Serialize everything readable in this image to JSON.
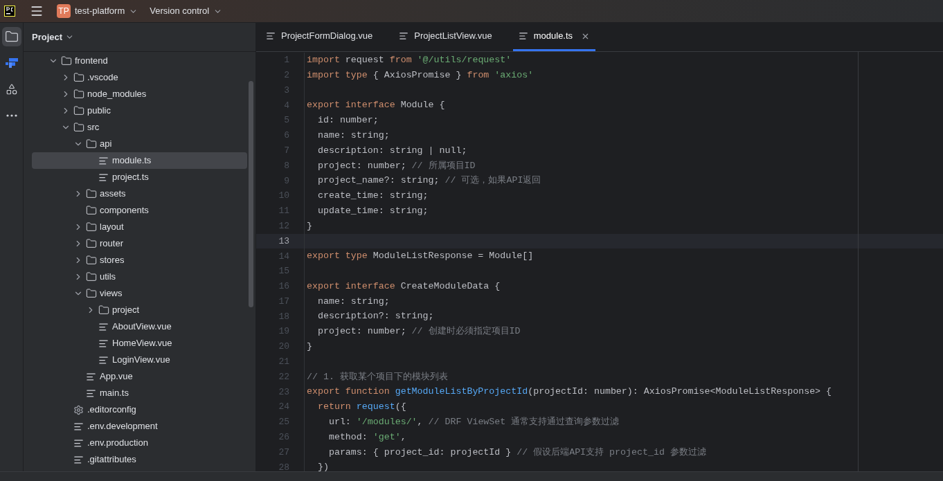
{
  "title_bar": {
    "app_badge": "TP",
    "project": "test-platform",
    "vcs": "Version control"
  },
  "side_rail": [
    {
      "kind": "folder",
      "selected": true
    },
    {
      "kind": "logo",
      "selected": false
    },
    {
      "kind": "components",
      "selected": false
    },
    {
      "kind": "more",
      "selected": false
    }
  ],
  "sidebar": {
    "title": "Project",
    "tree": [
      {
        "label": "frontend",
        "kind": "folder",
        "expanded": true,
        "selected": false,
        "children": [
          {
            "label": ".vscode",
            "kind": "folder",
            "expanded": false,
            "selected": false
          },
          {
            "label": "node_modules",
            "kind": "folder",
            "expanded": false,
            "selected": false
          },
          {
            "label": "public",
            "kind": "folder",
            "expanded": false,
            "selected": false
          },
          {
            "label": "src",
            "kind": "folder",
            "expanded": true,
            "selected": false,
            "children": [
              {
                "label": "api",
                "kind": "folder",
                "expanded": true,
                "selected": false,
                "children": [
                  {
                    "label": "module.ts",
                    "kind": "file",
                    "selected": true
                  },
                  {
                    "label": "project.ts",
                    "kind": "file",
                    "selected": false
                  }
                ]
              },
              {
                "label": "assets",
                "kind": "folder",
                "expanded": false,
                "selected": false
              },
              {
                "label": "components",
                "kind": "leaf_folder",
                "selected": false
              },
              {
                "label": "layout",
                "kind": "folder",
                "expanded": false,
                "selected": false
              },
              {
                "label": "router",
                "kind": "folder",
                "expanded": false,
                "selected": false
              },
              {
                "label": "stores",
                "kind": "folder",
                "expanded": false,
                "selected": false
              },
              {
                "label": "utils",
                "kind": "folder",
                "expanded": false,
                "selected": false
              },
              {
                "label": "views",
                "kind": "folder",
                "expanded": true,
                "selected": false,
                "children": [
                  {
                    "label": "project",
                    "kind": "folder",
                    "expanded": false,
                    "selected": false
                  },
                  {
                    "label": "AboutView.vue",
                    "kind": "file",
                    "selected": false
                  },
                  {
                    "label": "HomeView.vue",
                    "kind": "file",
                    "selected": false
                  },
                  {
                    "label": "LoginView.vue",
                    "kind": "file",
                    "selected": false
                  }
                ]
              },
              {
                "label": "App.vue",
                "kind": "file",
                "selected": false
              },
              {
                "label": "main.ts",
                "kind": "file",
                "selected": false
              }
            ]
          },
          {
            "label": ".editorconfig",
            "kind": "config",
            "selected": false
          },
          {
            "label": ".env.development",
            "kind": "file",
            "selected": false
          },
          {
            "label": ".env.production",
            "kind": "file",
            "selected": false
          },
          {
            "label": ".gitattributes",
            "kind": "file",
            "selected": false
          }
        ]
      }
    ]
  },
  "tabs": [
    {
      "label": "ProjectFormDialog.vue",
      "selected": false,
      "closable": false
    },
    {
      "label": "ProjectListView.vue",
      "selected": false,
      "closable": false
    },
    {
      "label": "module.ts",
      "selected": true,
      "closable": true
    }
  ],
  "editor": {
    "lines": [
      {
        "number": "1",
        "current": false,
        "tokens": [
          {
            "kind": "keyword",
            "text": "import "
          },
          {
            "kind": "plain",
            "text": "request "
          },
          {
            "kind": "keyword",
            "text": "from "
          },
          {
            "kind": "string",
            "text": "'@/utils/request'"
          }
        ]
      },
      {
        "number": "2",
        "current": false,
        "tokens": [
          {
            "kind": "keyword",
            "text": "import type "
          },
          {
            "kind": "plain",
            "text": "{ AxiosPromise } "
          },
          {
            "kind": "keyword",
            "text": "from "
          },
          {
            "kind": "string",
            "text": "'axios'"
          }
        ]
      },
      {
        "number": "3",
        "current": false
      },
      {
        "number": "4",
        "current": false,
        "tokens": [
          {
            "kind": "keyword",
            "text": "export interface "
          },
          {
            "kind": "plain",
            "text": "Module {"
          }
        ]
      },
      {
        "number": "5",
        "current": false,
        "tokens": [
          {
            "kind": "plain",
            "text": "  id: number;"
          }
        ]
      },
      {
        "number": "6",
        "current": false,
        "tokens": [
          {
            "kind": "plain",
            "text": "  name: string;"
          }
        ]
      },
      {
        "number": "7",
        "current": false,
        "tokens": [
          {
            "kind": "plain",
            "text": "  description: string | null;"
          }
        ]
      },
      {
        "number": "8",
        "current": false,
        "tokens": [
          {
            "kind": "plain",
            "text": "  project: number; "
          },
          {
            "kind": "comment",
            "text": "// 所属项目ID"
          }
        ]
      },
      {
        "number": "9",
        "current": false,
        "tokens": [
          {
            "kind": "plain",
            "text": "  project_name?: string; "
          },
          {
            "kind": "comment",
            "text": "// 可选，如果API返回"
          }
        ]
      },
      {
        "number": "10",
        "current": false,
        "tokens": [
          {
            "kind": "plain",
            "text": "  create_time: string;"
          }
        ]
      },
      {
        "number": "11",
        "current": false,
        "tokens": [
          {
            "kind": "plain",
            "text": "  update_time: string;"
          }
        ]
      },
      {
        "number": "12",
        "current": false,
        "tokens": [
          {
            "kind": "plain",
            "text": "}"
          }
        ]
      },
      {
        "number": "13",
        "current": true
      },
      {
        "number": "14",
        "current": false,
        "tokens": [
          {
            "kind": "keyword",
            "text": "export type "
          },
          {
            "kind": "plain",
            "text": "ModuleListResponse = Module[]"
          }
        ]
      },
      {
        "number": "15",
        "current": false
      },
      {
        "number": "16",
        "current": false,
        "tokens": [
          {
            "kind": "keyword",
            "text": "export interface "
          },
          {
            "kind": "plain",
            "text": "CreateModuleData {"
          }
        ]
      },
      {
        "number": "17",
        "current": false,
        "tokens": [
          {
            "kind": "plain",
            "text": "  name: string;"
          }
        ]
      },
      {
        "number": "18",
        "current": false,
        "tokens": [
          {
            "kind": "plain",
            "text": "  description?: string;"
          }
        ]
      },
      {
        "number": "19",
        "current": false,
        "tokens": [
          {
            "kind": "plain",
            "text": "  project: number; "
          },
          {
            "kind": "comment",
            "text": "// 创建时必须指定项目ID"
          }
        ]
      },
      {
        "number": "20",
        "current": false,
        "tokens": [
          {
            "kind": "plain",
            "text": "}"
          }
        ]
      },
      {
        "number": "21",
        "current": false
      },
      {
        "number": "22",
        "current": false,
        "tokens": [
          {
            "kind": "comment",
            "text": "// 1. 获取某个项目下的模块列表"
          }
        ]
      },
      {
        "number": "23",
        "current": false,
        "tokens": [
          {
            "kind": "keyword",
            "text": "export function "
          },
          {
            "kind": "function",
            "text": "getModuleListByProjectId"
          },
          {
            "kind": "plain",
            "text": "(projectId: number): AxiosPromise<ModuleListResponse> {"
          }
        ]
      },
      {
        "number": "24",
        "current": false,
        "tokens": [
          {
            "kind": "keyword",
            "text": "  return "
          },
          {
            "kind": "function",
            "text": "request"
          },
          {
            "kind": "plain",
            "text": "({"
          }
        ]
      },
      {
        "number": "25",
        "current": false,
        "tokens": [
          {
            "kind": "plain",
            "text": "    url: "
          },
          {
            "kind": "string",
            "text": "'/modules/'"
          },
          {
            "kind": "plain",
            "text": ", "
          },
          {
            "kind": "comment",
            "text": "// DRF ViewSet 通常支持通过查询参数过滤"
          }
        ]
      },
      {
        "number": "26",
        "current": false,
        "tokens": [
          {
            "kind": "plain",
            "text": "    method: "
          },
          {
            "kind": "string",
            "text": "'get'"
          },
          {
            "kind": "plain",
            "text": ","
          }
        ]
      },
      {
        "number": "27",
        "current": false,
        "tokens": [
          {
            "kind": "plain",
            "text": "    params: { project_id: projectId } "
          },
          {
            "kind": "comment",
            "text": "// 假设后端API支持 project_id 参数过滤"
          }
        ]
      },
      {
        "number": "28",
        "current": false,
        "tokens": [
          {
            "kind": "plain",
            "text": "  })"
          }
        ]
      }
    ]
  }
}
